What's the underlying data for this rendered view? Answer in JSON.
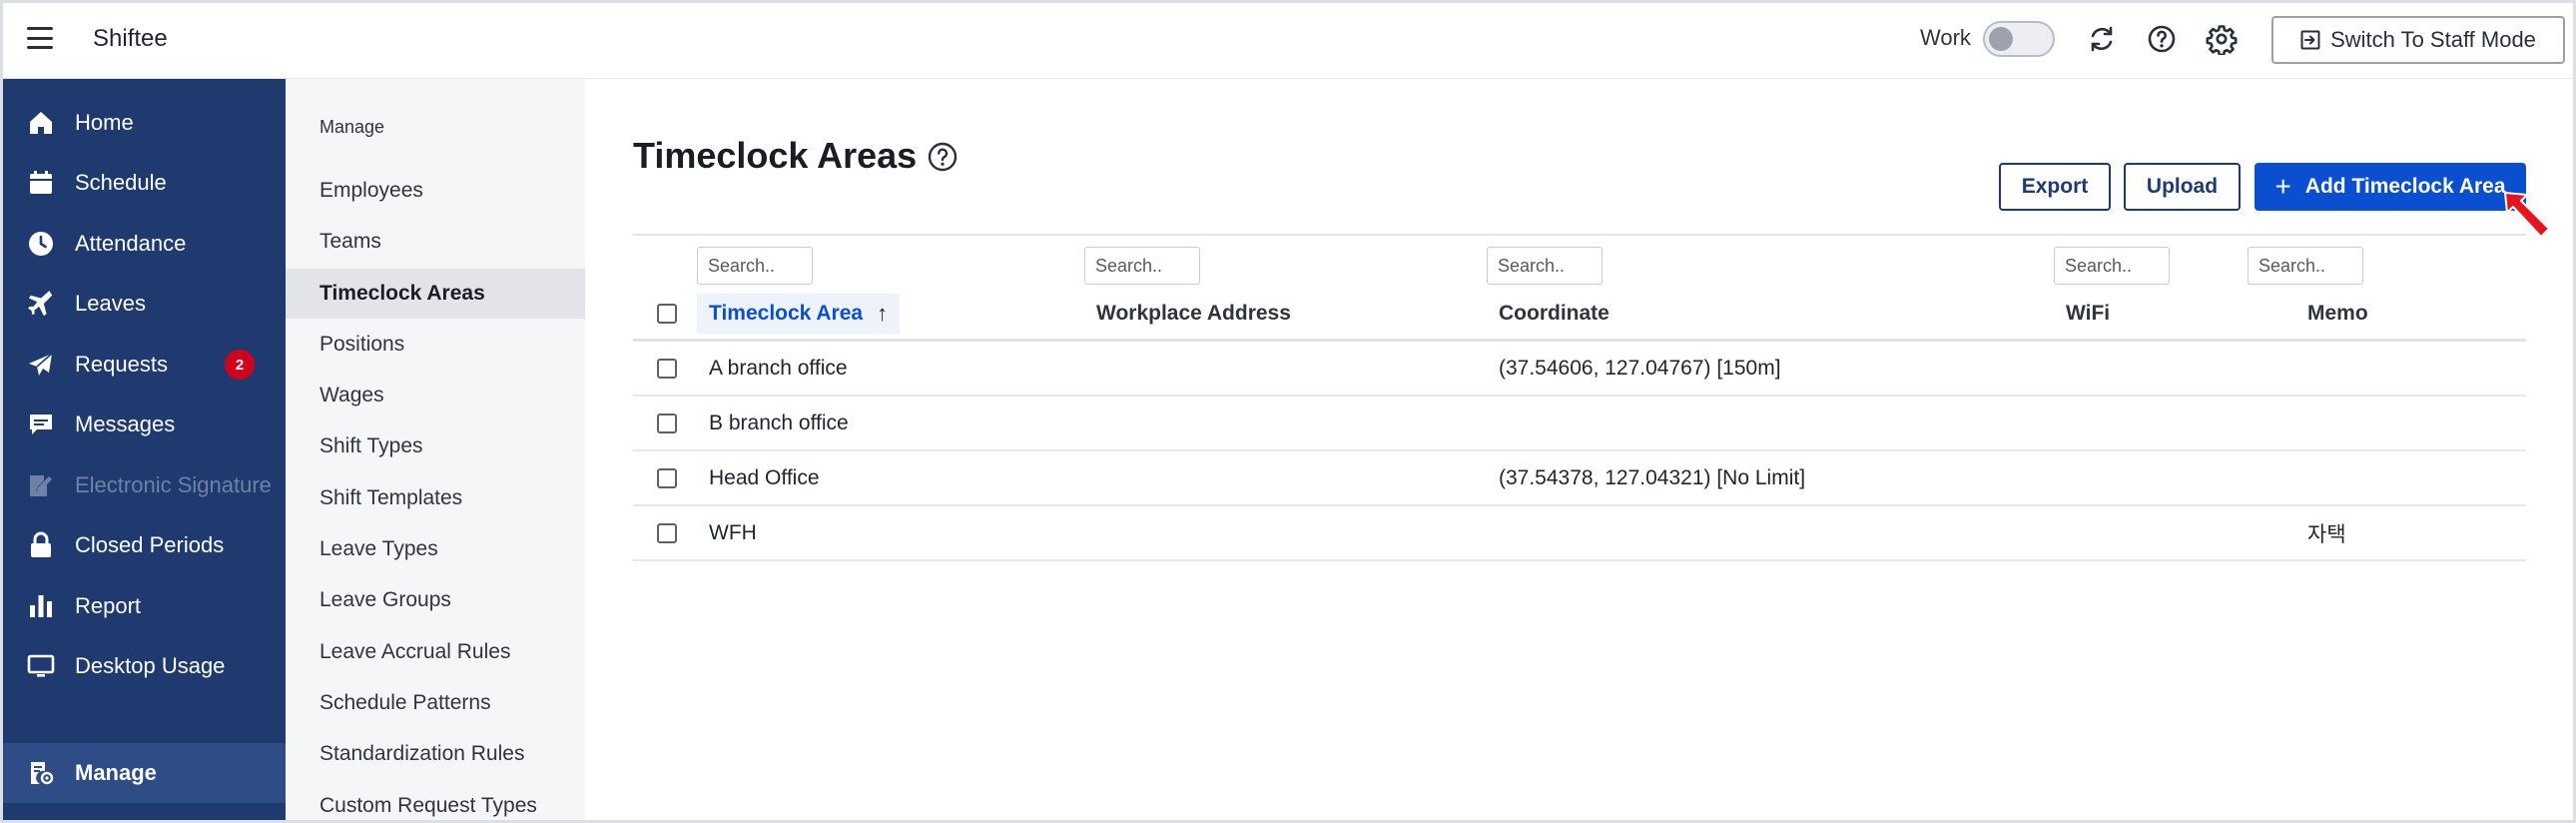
{
  "header": {
    "brand": "Shiftee",
    "work_label": "Work",
    "switch_label": "Switch To Staff Mode"
  },
  "nav": {
    "items": [
      {
        "label": "Home",
        "icon": "home-icon"
      },
      {
        "label": "Schedule",
        "icon": "calendar-icon"
      },
      {
        "label": "Attendance",
        "icon": "clock-icon"
      },
      {
        "label": "Leaves",
        "icon": "plane-icon"
      },
      {
        "label": "Requests",
        "icon": "send-icon",
        "badge": "2"
      },
      {
        "label": "Messages",
        "icon": "message-icon"
      },
      {
        "label": "Electronic Signature",
        "icon": "pen-icon"
      },
      {
        "label": "Closed Periods",
        "icon": "lock-icon"
      },
      {
        "label": "Report",
        "icon": "bar-chart-icon"
      },
      {
        "label": "Desktop Usage",
        "icon": "monitor-icon"
      },
      {
        "label": "Manage",
        "icon": "manage-icon"
      }
    ]
  },
  "sub": {
    "title": "Manage",
    "items": [
      "Employees",
      "Teams",
      "Timeclock Areas",
      "Positions",
      "Wages",
      "Shift Types",
      "Shift Templates",
      "Leave Types",
      "Leave Groups",
      "Leave Accrual Rules",
      "Schedule Patterns",
      "Standardization Rules",
      "Custom Request Types"
    ]
  },
  "main": {
    "title": "Timeclock Areas",
    "export_label": "Export",
    "upload_label": "Upload",
    "add_label": "Add Timeclock Area",
    "search_placeholder": "Search..",
    "columns": [
      "Timeclock Area",
      "Workplace Address",
      "Coordinate",
      "WiFi",
      "Memo"
    ],
    "rows": [
      {
        "area": "A branch office",
        "address": "",
        "coordinate": "(37.54606, 127.04767) [150m]",
        "wifi": "",
        "memo": ""
      },
      {
        "area": "B branch office",
        "address": "",
        "coordinate": "",
        "wifi": "",
        "memo": ""
      },
      {
        "area": "Head Office",
        "address": "",
        "coordinate": "(37.54378, 127.04321) [No Limit]",
        "wifi": "",
        "memo": ""
      },
      {
        "area": "WFH",
        "address": "",
        "coordinate": "",
        "wifi": "",
        "memo": "자택"
      }
    ]
  },
  "colors": {
    "nav_bg": "#1e3a6e",
    "primary": "#0a4fcf",
    "badge": "#d0021b",
    "cursor": "#e8141b"
  }
}
